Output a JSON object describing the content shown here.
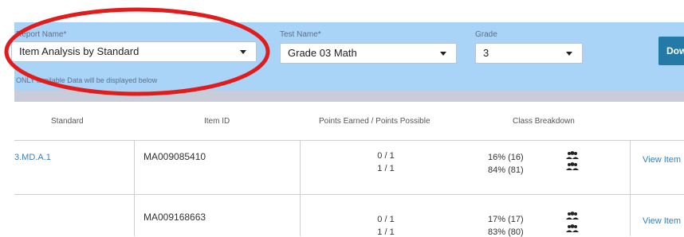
{
  "filters": {
    "report": {
      "label": "Report Name*",
      "value": "Item Analysis by Standard"
    },
    "test": {
      "label": "Test Name*",
      "value": "Grade 03 Math"
    },
    "grade": {
      "label": "Grade",
      "value": "3"
    },
    "download_label": "Dow",
    "note": "ONLY available Data will be displayed below"
  },
  "table": {
    "headers": [
      "Standard",
      "Item ID",
      "Points Earned / Points Possible",
      "Class Breakdown"
    ],
    "rows": [
      {
        "standard": "3.MD.A.1",
        "item_id": "MA009085410",
        "points": [
          "0 / 1",
          "1 / 1"
        ],
        "breakdown": [
          "16% (16)",
          "84% (81)"
        ],
        "action": "View Item"
      },
      {
        "standard": "",
        "item_id": "MA009168663",
        "points": [
          "0 / 1",
          "1 / 1"
        ],
        "breakdown": [
          "17% (17)",
          "83% (80)"
        ],
        "action": "View Item"
      }
    ]
  },
  "colors": {
    "filter_bar": "#a9d3f7",
    "annotation_ring": "#e01d1d",
    "download": "#247aa6",
    "link": "#3a7fb7"
  },
  "icons": [
    "chevron-down-icon",
    "group-icon"
  ]
}
